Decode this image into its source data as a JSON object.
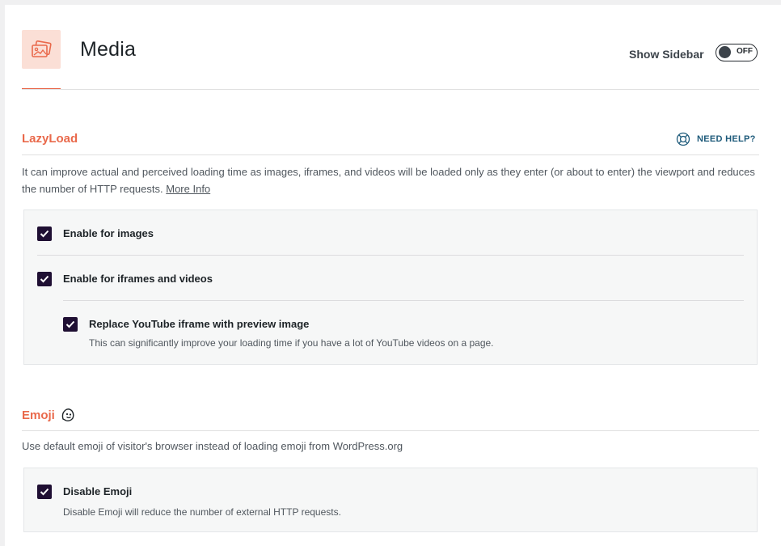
{
  "header": {
    "title": "Media",
    "sidebar_label": "Show Sidebar",
    "sidebar_toggle_state": "OFF"
  },
  "lazyload": {
    "title": "LazyLoad",
    "help_label": "NEED HELP?",
    "description": "It can improve actual and perceived loading time as images, iframes, and videos will be loaded only as they enter (or about to enter) the viewport and reduces the number of HTTP requests.",
    "more_info": "More Info",
    "options": [
      {
        "label": "Enable for images",
        "checked": true
      },
      {
        "label": "Enable for iframes and videos",
        "checked": true
      },
      {
        "label": "Replace YouTube iframe with preview image",
        "checked": true,
        "sub": "This can significantly improve your loading time if you have a lot of YouTube videos on a page."
      }
    ]
  },
  "emoji": {
    "title": "Emoji",
    "description": "Use default emoji of visitor's browser instead of loading emoji from WordPress.org",
    "option": {
      "label": "Disable Emoji",
      "checked": true,
      "sub": "Disable Emoji will reduce the number of external HTTP requests."
    }
  },
  "colors": {
    "accent": "#e9694b",
    "checkbox": "#1f0f33",
    "help": "#1d5a7a"
  }
}
